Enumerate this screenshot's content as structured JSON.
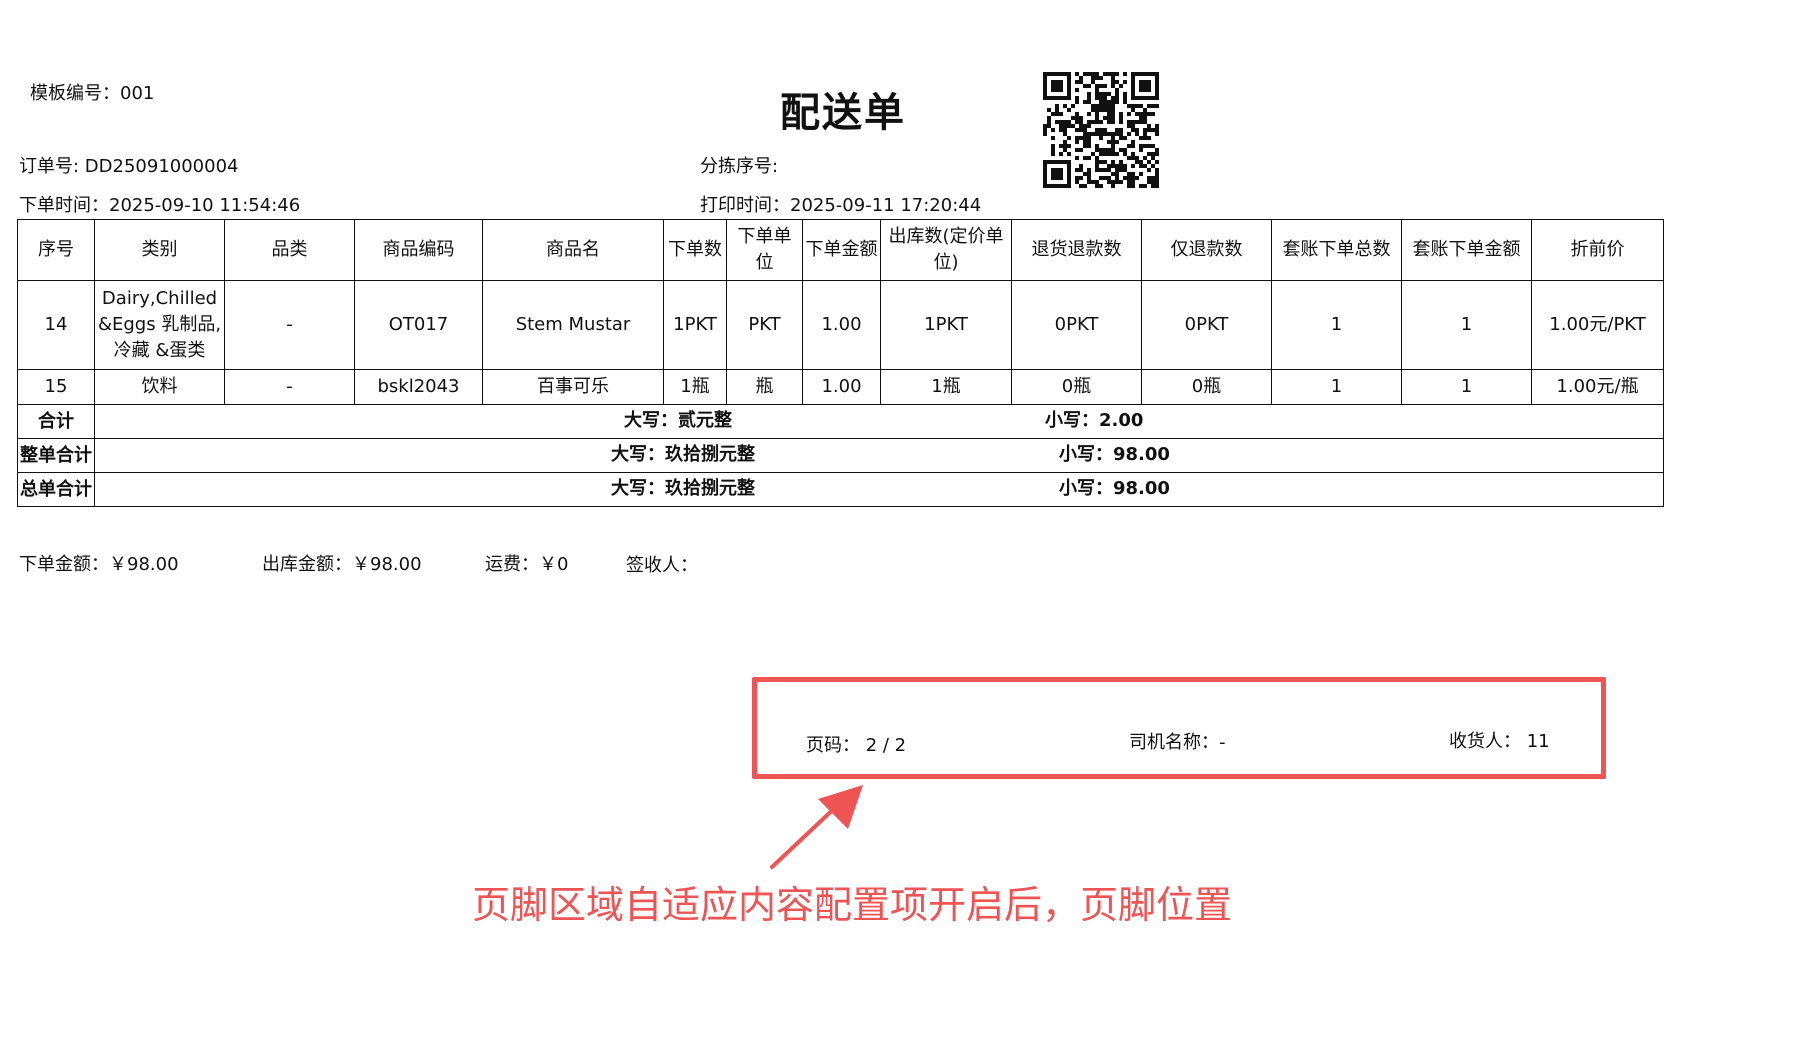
{
  "header": {
    "template_no": "模板编号：001",
    "title": "配送单",
    "order_no": "订单号: DD25091000004",
    "sort_no": "分拣序号:",
    "order_time": "下单时间：2025-09-10 11:54:46",
    "print_time": "打印时间：2025-09-11 17:20:44"
  },
  "table": {
    "columns": [
      "序号",
      "类别",
      "品类",
      "商品编码",
      "商品名",
      "下单数",
      "下单单位",
      "下单金额",
      "出库数(定价单位)",
      "退货退款数",
      "仅退款数",
      "套账下单总数",
      "套账下单金额",
      "折前价"
    ],
    "rows": [
      [
        "14",
        "Dairy,Chilled&Eggs 乳制品,冷藏 &蛋类",
        "-",
        "OT017",
        "Stem Mustar",
        "1PKT",
        "PKT",
        "1.00",
        "1PKT",
        "0PKT",
        "0PKT",
        "1",
        "1",
        "1.00元/PKT"
      ],
      [
        "15",
        "饮料",
        "-",
        "bskl2043",
        "百事可乐",
        "1瓶",
        "瓶",
        "1.00",
        "1瓶",
        "0瓶",
        "0瓶",
        "1",
        "1",
        "1.00元/瓶"
      ]
    ],
    "summary": [
      {
        "label": "合计",
        "upper": "大写：贰元整",
        "lower": "小写：2.00"
      },
      {
        "label": "整单合计",
        "upper": "大写：玖拾捌元整",
        "lower": "小写：98.00"
      },
      {
        "label": "总单合计",
        "upper": "大写：玖拾捌元整",
        "lower": "小写：98.00"
      }
    ]
  },
  "totals": {
    "order_amount": "下单金额：￥98.00",
    "out_amount": "出库金额：￥98.00",
    "freight": "运费：￥0",
    "receiver_sign": "签收人："
  },
  "footer": {
    "page": "页码：  2 / 2",
    "driver": "司机名称：-",
    "consignee": "收货人：  11"
  },
  "annotation": {
    "text": "页脚区域自适应内容配置项开启后，页脚位置",
    "color": "#ee5454"
  }
}
